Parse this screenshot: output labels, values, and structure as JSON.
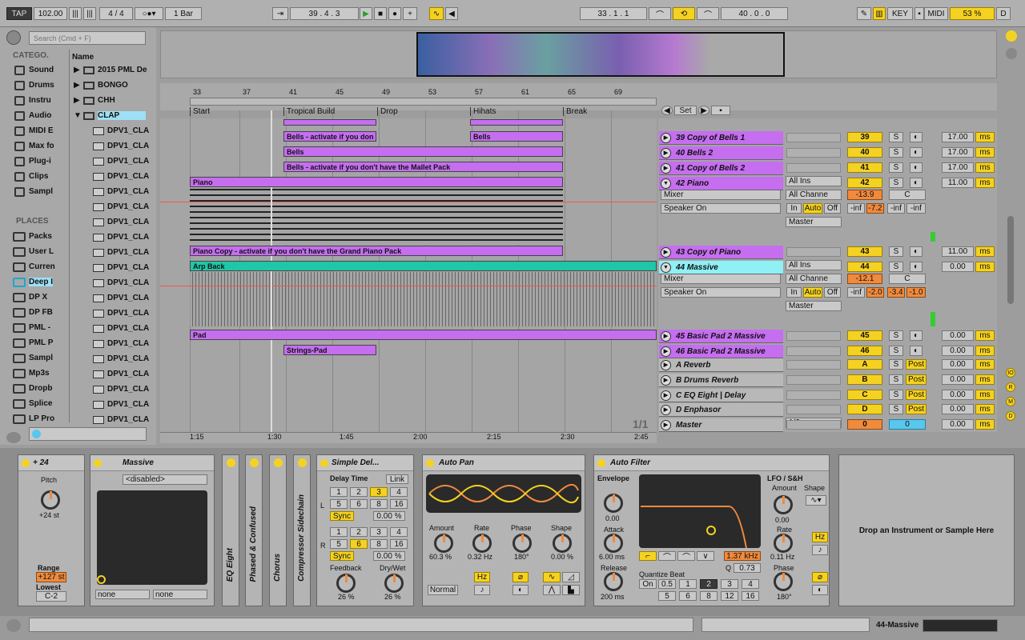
{
  "transport": {
    "tap": "TAP",
    "bpm": "102.00",
    "signature": "4 / 4",
    "quant": "1 Bar",
    "position": "39 . 4 . 3",
    "loop_start": "33 . 1 . 1",
    "loop_len": "40 . 0 . 0",
    "key": "KEY",
    "midi": "MIDI",
    "cpu": "53 %",
    "d": "D"
  },
  "browser": {
    "search_placeholder": "Search (Cmd + F)",
    "categories_header": "CATEGO.",
    "name_header": "Name",
    "places_header": "PLACES",
    "categories": [
      "Sound",
      "Drums",
      "Instru",
      "Audio",
      "MIDI E",
      "Max fo",
      "Plug-i",
      "Clips",
      "Sampl"
    ],
    "places": [
      "Packs",
      "User L",
      "Curren",
      "Deep I",
      "DP X",
      "DP FB",
      "PML -",
      "PML P",
      "Sampl",
      "Mp3s",
      "Dropb",
      "Splice",
      "LP Pro"
    ],
    "folders": [
      "2015 PML De",
      "BONGO",
      "CHH",
      "CLAP"
    ],
    "files": [
      "DPV1_CLA",
      "DPV1_CLA",
      "DPV1_CLA",
      "DPV1_CLA",
      "DPV1_CLA",
      "DPV1_CLA",
      "DPV1_CLA",
      "DPV1_CLA",
      "DPV1_CLA",
      "DPV1_CLA",
      "DPV1_CLA",
      "DPV1_CLA",
      "DPV1_CLA",
      "DPV1_CLA",
      "DPV1_CLA",
      "DPV1_CLA",
      "DPV1_CLA",
      "DPV1_CLA",
      "DPV1_CLA",
      "DPV1_CLA"
    ]
  },
  "arrangement": {
    "bars": [
      "33",
      "37",
      "41",
      "45",
      "49",
      "53",
      "57",
      "61",
      "65",
      "69"
    ],
    "locators": [
      "Start",
      "Tropical Build",
      "Drop",
      "Hihats",
      "Break"
    ],
    "set_label": "Set",
    "times": [
      "1:15",
      "1:30",
      "1:45",
      "2:00",
      "2:15",
      "2:30",
      "2:45"
    ],
    "page": "1/1"
  },
  "clips": [
    "Bells - activate if you don",
    "Bells",
    "Bells",
    "Bells - activate if you don't have the Mallet Pack",
    "Piano",
    "Piano Copy - activate if you don't have the Grand Piano Pack",
    "Arp Back",
    "Pad",
    "Strings-Pad"
  ],
  "tracks": [
    {
      "name": "39 Copy of Bells 1",
      "num": "39",
      "vol": "17.00"
    },
    {
      "name": "40 Bells 2",
      "num": "40",
      "vol": "17.00"
    },
    {
      "name": "41 Copy of Bells 2",
      "num": "41",
      "vol": "17.00"
    },
    {
      "name": "42 Piano",
      "num": "42",
      "vol": "11.00"
    },
    {
      "name": "43 Copy of Piano",
      "num": "43",
      "vol": "11.00"
    },
    {
      "name": "44 Massive",
      "num": "44",
      "vol": "0.00"
    },
    {
      "name": "45 Basic Pad 2 Massive",
      "num": "45",
      "vol": "0.00"
    },
    {
      "name": "46 Basic Pad 2 Massive",
      "num": "46",
      "vol": "0.00"
    },
    {
      "name": "A Reverb",
      "num": "A",
      "vol": "0.00"
    },
    {
      "name": "B Drums Reverb",
      "num": "B",
      "vol": "0.00"
    },
    {
      "name": "C EQ Eight | Delay",
      "num": "C",
      "vol": "0.00"
    },
    {
      "name": "D Enphasor",
      "num": "D",
      "vol": "0.00"
    },
    {
      "name": "Master",
      "num": "0",
      "vol": "0.00"
    }
  ],
  "io": {
    "all_ins": "All Ins",
    "mixer": "Mixer",
    "all_channels": "All Channe",
    "speaker_on": "Speaker On",
    "in": "In",
    "auto": "Auto",
    "off": "Off",
    "master": "Master",
    "inf": "-inf",
    "s": "S",
    "post": "Post",
    "ms": "ms",
    "c": "C",
    "half": "1/2",
    "piano": {
      "vol": "-13.9",
      "send2": "-7.2"
    },
    "massive": {
      "vol": "-12.1",
      "s2": "-2.0",
      "s3": "-3.4",
      "s4": "-1.0"
    }
  },
  "devices": {
    "pitch": {
      "title": "+ 24",
      "pitch": "Pitch",
      "st": "+24 st",
      "range": "Range",
      "range_val": "+127 st",
      "lowest": "Lowest",
      "lowest_val": "C-2"
    },
    "massive": {
      "title": "Massive",
      "preset": "<disabled>",
      "none1": "none",
      "none2": "none"
    },
    "vertical": [
      "EQ Eight",
      "Phased & Confused",
      "Chorus",
      "Compressor Sidechain"
    ],
    "delay": {
      "title": "Simple Del...",
      "delay_time": "Delay Time",
      "link": "Link",
      "sync": "Sync",
      "pct": "0.00 %",
      "feedback": "Feedback",
      "drywet": "Dry/Wet",
      "fb_val": "26 %",
      "dw_val": "26 %",
      "grid": [
        "1",
        "2",
        "3",
        "4",
        "5",
        "6",
        "8",
        "16"
      ]
    },
    "autopan": {
      "title": "Auto Pan",
      "amount": "Amount",
      "rate": "Rate",
      "phase": "Phase",
      "shape": "Shape",
      "amount_v": "60.3 %",
      "rate_v": "0.32 Hz",
      "phase_v": "180°",
      "shape_v": "0.00 %",
      "normal": "Normal",
      "hz": "Hz"
    },
    "autofilter": {
      "title": "Auto Filter",
      "envelope": "Envelope",
      "env_v": "0.00",
      "attack": "Attack",
      "attack_v": "6.00 ms",
      "release": "Release",
      "release_v": "200 ms",
      "freq": "1.37 kHz",
      "q": "Q",
      "q_v": "0.73",
      "qb": "Quantize Beat",
      "on": "On",
      "qvals": [
        "0.5",
        "1",
        "2",
        "3",
        "4",
        "5",
        "6",
        "8",
        "12",
        "16"
      ],
      "lfo": "LFO / S&H",
      "amount": "Amount",
      "shape": "Shape",
      "amount_v": "0.00",
      "rate": "Rate",
      "rate_v": "0.11 Hz",
      "phase": "Phase",
      "phase_v": "180°",
      "hz": "Hz"
    },
    "drop": "Drop an Instrument or Sample Here"
  },
  "status": {
    "track": "44-Massive"
  }
}
